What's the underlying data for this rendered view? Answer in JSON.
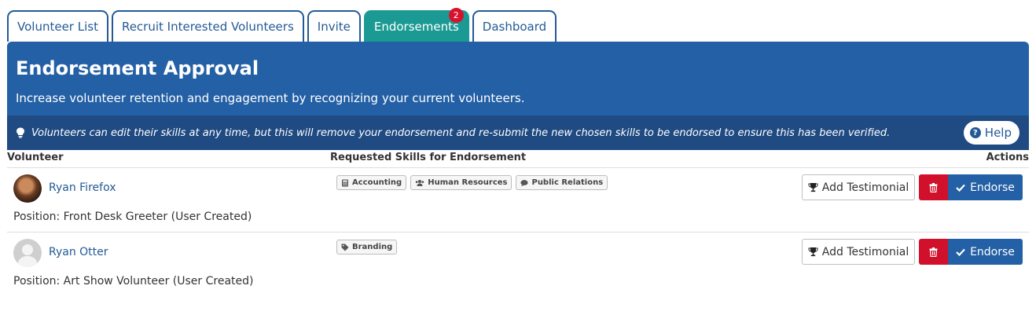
{
  "tabs": [
    {
      "label": "Volunteer List"
    },
    {
      "label": "Recruit Interested Volunteers"
    },
    {
      "label": "Invite"
    },
    {
      "label": "Endorsements",
      "badge": "2",
      "active": true
    },
    {
      "label": "Dashboard"
    }
  ],
  "header": {
    "title": "Endorsement Approval",
    "subtitle": "Increase volunteer retention and engagement by recognizing your current volunteers.",
    "notice": "Volunteers can edit their skills at any time, but this will remove your endorsement and re-submit the new chosen skills to be endorsed to ensure this has been verified.",
    "help_label": "Help",
    "notice_icon": "lightbulb-icon"
  },
  "table": {
    "columns": {
      "volunteer": "Volunteer",
      "skills": "Requested Skills for Endorsement",
      "actions": "Actions"
    },
    "rows": [
      {
        "name": "Ryan Firefox",
        "position": "Position: Front Desk Greeter (User Created)",
        "avatar": "photo",
        "skills": [
          {
            "label": "Accounting",
            "icon": "calculator-icon"
          },
          {
            "label": "Human Resources",
            "icon": "users-icon"
          },
          {
            "label": "Public Relations",
            "icon": "comment-icon"
          }
        ]
      },
      {
        "name": "Ryan Otter",
        "position": "Position: Art Show Volunteer (User Created)",
        "avatar": "default",
        "skills": [
          {
            "label": "Branding",
            "icon": "tag-icon"
          }
        ]
      }
    ]
  },
  "actions": {
    "testimonial_label": "Add Testimonial",
    "endorse_label": "Endorse"
  },
  "colors": {
    "primary": "#2460a5",
    "active_tab": "#1b9a94",
    "notice_bg": "#1f4a82",
    "danger": "#d1112b",
    "badge": "#d8112c"
  }
}
